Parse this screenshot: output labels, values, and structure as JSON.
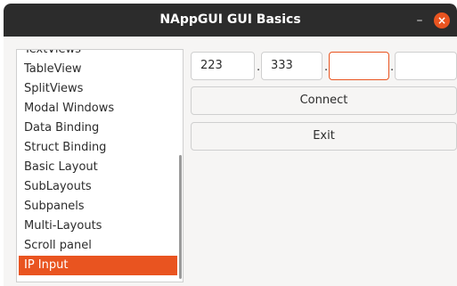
{
  "window": {
    "title": "NAppGUI GUI Basics",
    "minimize_glyph": "–",
    "close_glyph": "×",
    "accent_color": "#e95420"
  },
  "sidebar": {
    "items": [
      {
        "label": "TextViews"
      },
      {
        "label": "TableView"
      },
      {
        "label": "SplitViews"
      },
      {
        "label": "Modal Windows"
      },
      {
        "label": "Data Binding"
      },
      {
        "label": "Struct Binding"
      },
      {
        "label": "Basic Layout"
      },
      {
        "label": "SubLayouts"
      },
      {
        "label": "Subpanels"
      },
      {
        "label": "Multi-Layouts"
      },
      {
        "label": "Scroll panel"
      },
      {
        "label": "IP Input"
      }
    ],
    "selected": "IP Input"
  },
  "ip": {
    "octets": [
      "223",
      "333",
      "",
      ""
    ],
    "separator": "."
  },
  "buttons": {
    "connect": "Connect",
    "exit": "Exit"
  }
}
